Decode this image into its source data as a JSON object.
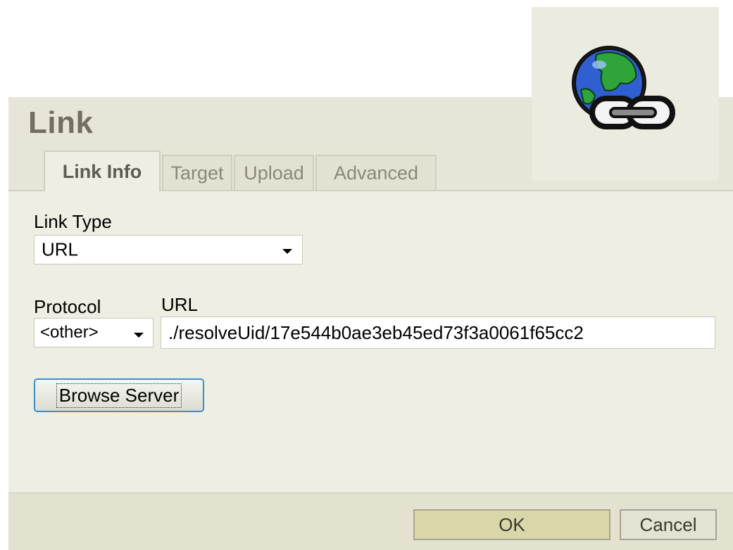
{
  "dialog": {
    "title": "Link",
    "tabs": [
      {
        "label": "Link Info",
        "active": true
      },
      {
        "label": "Target",
        "active": false
      },
      {
        "label": "Upload",
        "active": false
      },
      {
        "label": "Advanced",
        "active": false
      }
    ]
  },
  "link_info": {
    "link_type_label": "Link Type",
    "link_type_value": "URL",
    "protocol_label": "Protocol",
    "protocol_value": "<other>",
    "url_label": "URL",
    "url_value": "./resolveUid/17e544b0ae3eb45ed73f3a0061f65cc2",
    "browse_label": "Browse Server"
  },
  "footer": {
    "ok_label": "OK",
    "cancel_label": "Cancel"
  },
  "icons": {
    "dialog_icon": "globe-link-icon",
    "dropdown_arrow": "chevron-down-icon"
  },
  "colors": {
    "dialog_bg": "#efeee2",
    "title_text": "#726e62",
    "ok_bg": "#d9d7aa",
    "focus_border": "#3d8ec9"
  }
}
